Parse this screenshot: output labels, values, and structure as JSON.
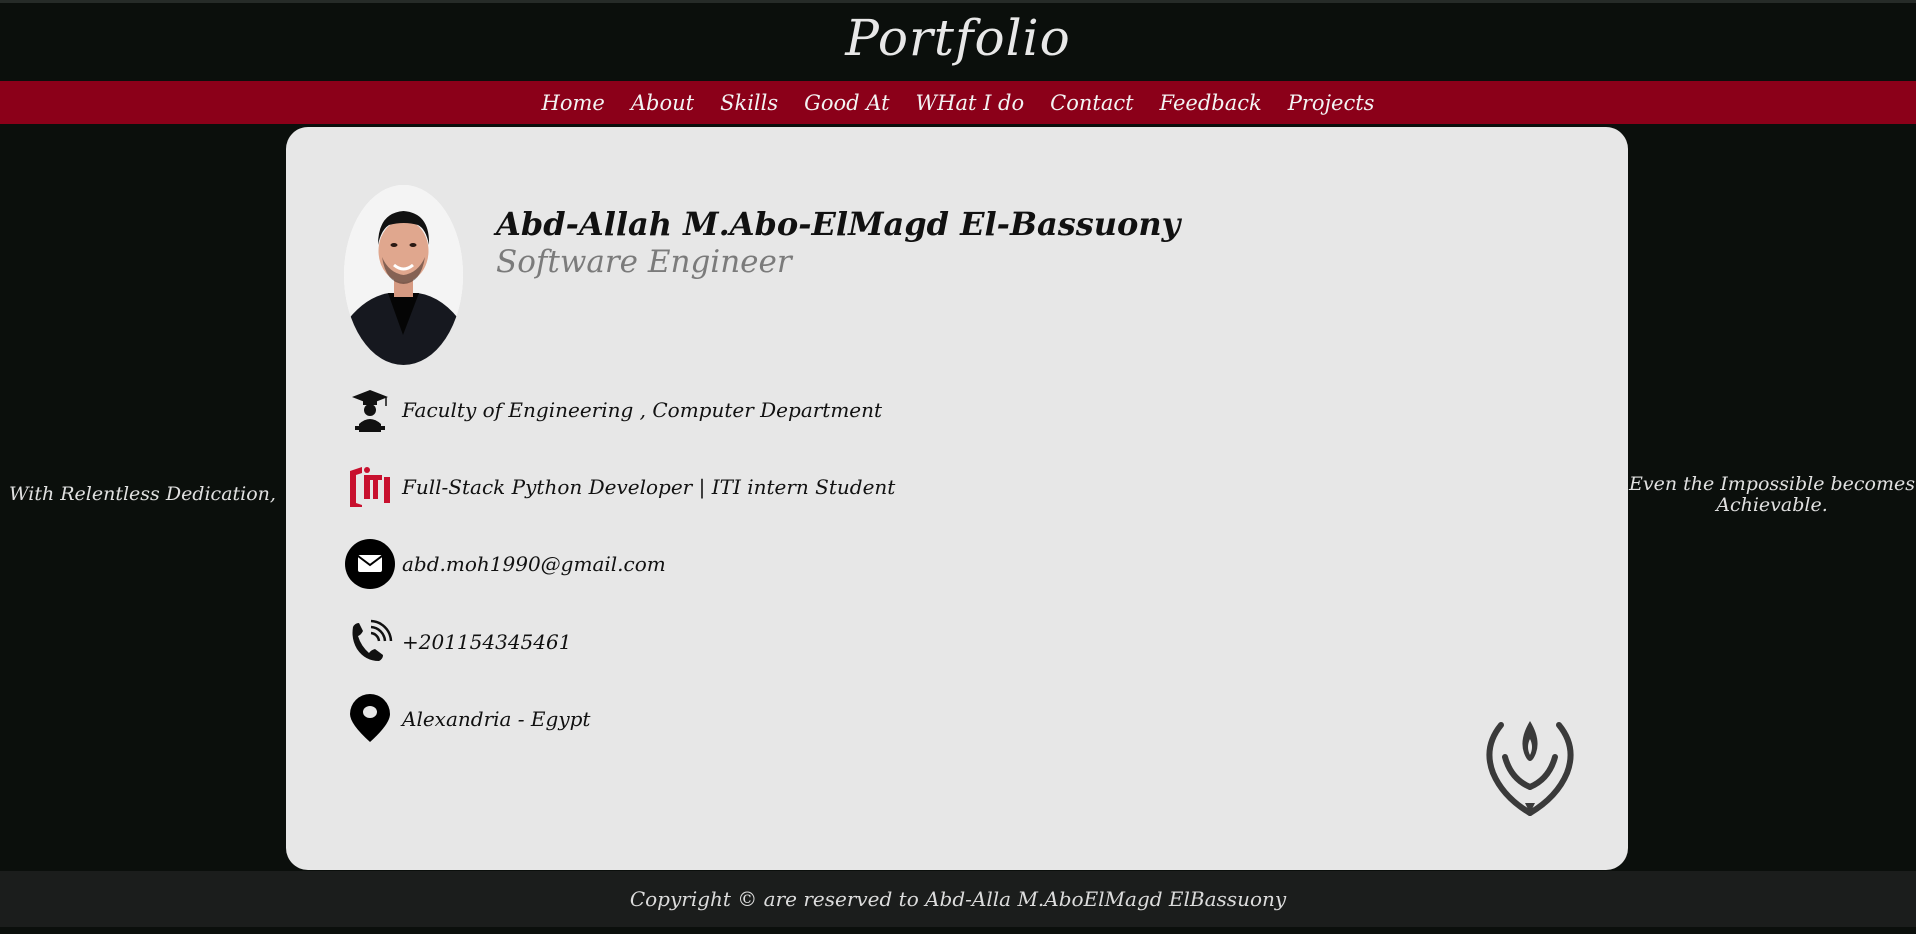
{
  "header": {
    "title": "Portfolio"
  },
  "nav": {
    "items": [
      "Home",
      "About",
      "Skills",
      "Good At",
      "WHat I do",
      "Contact",
      "Feedback",
      "Projects"
    ]
  },
  "side": {
    "left_quote": "With Relentless Dedication,",
    "right_quote": "Even the Impossible becomes Achievable."
  },
  "profile": {
    "name": "Abd-Allah M.Abo-ElMagd El-Bassuony",
    "role": "Software Engineer",
    "info": {
      "education": "Faculty of Engineering , Computer Department",
      "work": "Full-Stack Python Developer | ITI intern Student",
      "email": "abd.moh1990@gmail.com",
      "phone": "+201154345461",
      "location": "Alexandria - Egypt"
    },
    "icons": {
      "education": "graduate-icon",
      "work": "iti-logo-icon",
      "email": "envelope-icon",
      "phone": "phone-icon",
      "location": "location-pin-icon"
    }
  },
  "footer": {
    "copyright": "Copyright © are reserved to Abd-Alla M.AboElMagd ElBassuony"
  },
  "colors": {
    "background": "#0b0f0c",
    "nav_bar": "#8b0019",
    "card": "#e7e7e7",
    "footer": "#1b1d1c",
    "iti_red": "#c8102e"
  }
}
